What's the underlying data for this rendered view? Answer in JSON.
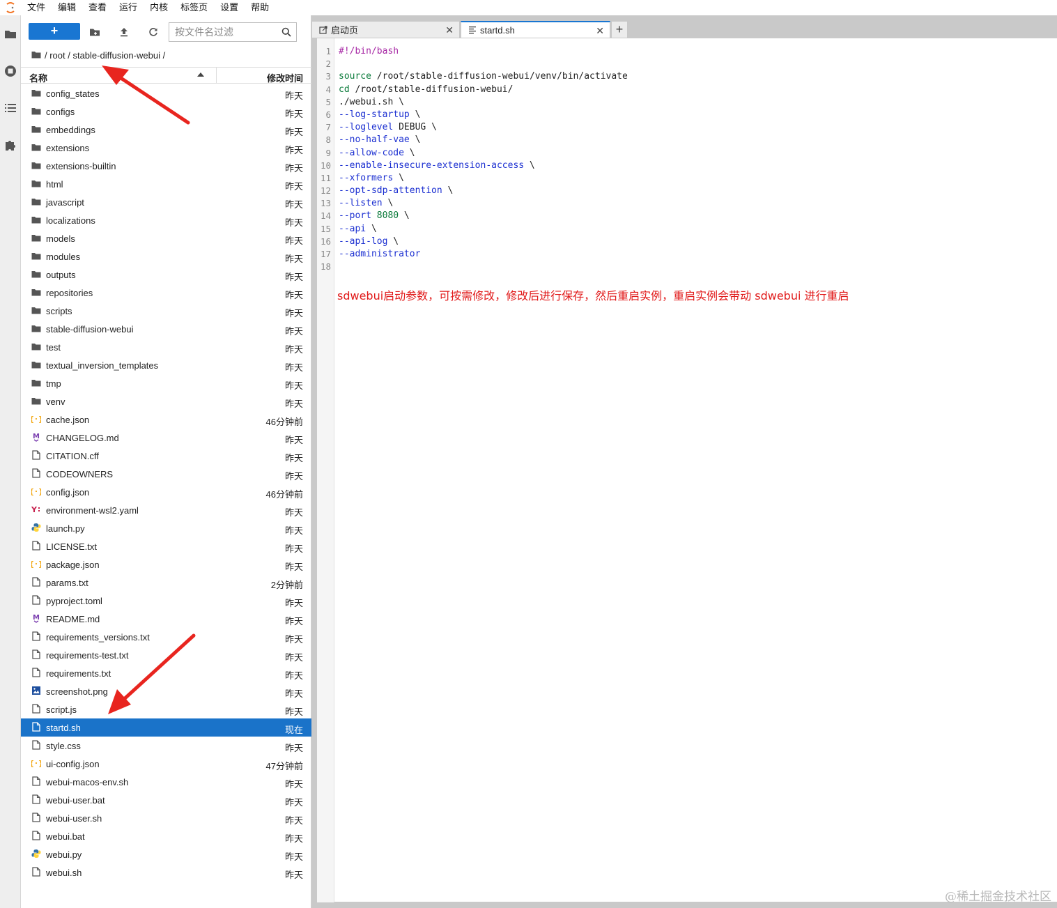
{
  "menubar": {
    "items": [
      "文件",
      "编辑",
      "查看",
      "运行",
      "内核",
      "标签页",
      "设置",
      "帮助"
    ]
  },
  "toolbar": {
    "new_label": "+",
    "filter_placeholder": "按文件名过滤",
    "icons": [
      "new-folder-icon",
      "upload-icon",
      "refresh-icon",
      "search-icon"
    ]
  },
  "breadcrumb": {
    "path": "/ root / stable-diffusion-webui /"
  },
  "filelist": {
    "header_name": "名称",
    "header_modified": "修改时间",
    "files": [
      {
        "name": "config_states",
        "type": "folder",
        "modified": "昨天"
      },
      {
        "name": "configs",
        "type": "folder",
        "modified": "昨天"
      },
      {
        "name": "embeddings",
        "type": "folder",
        "modified": "昨天"
      },
      {
        "name": "extensions",
        "type": "folder",
        "modified": "昨天"
      },
      {
        "name": "extensions-builtin",
        "type": "folder",
        "modified": "昨天"
      },
      {
        "name": "html",
        "type": "folder",
        "modified": "昨天"
      },
      {
        "name": "javascript",
        "type": "folder",
        "modified": "昨天"
      },
      {
        "name": "localizations",
        "type": "folder",
        "modified": "昨天"
      },
      {
        "name": "models",
        "type": "folder",
        "modified": "昨天"
      },
      {
        "name": "modules",
        "type": "folder",
        "modified": "昨天"
      },
      {
        "name": "outputs",
        "type": "folder",
        "modified": "昨天"
      },
      {
        "name": "repositories",
        "type": "folder",
        "modified": "昨天"
      },
      {
        "name": "scripts",
        "type": "folder",
        "modified": "昨天"
      },
      {
        "name": "stable-diffusion-webui",
        "type": "folder",
        "modified": "昨天"
      },
      {
        "name": "test",
        "type": "folder",
        "modified": "昨天"
      },
      {
        "name": "textual_inversion_templates",
        "type": "folder",
        "modified": "昨天"
      },
      {
        "name": "tmp",
        "type": "folder",
        "modified": "昨天"
      },
      {
        "name": "venv",
        "type": "folder",
        "modified": "昨天"
      },
      {
        "name": "cache.json",
        "type": "json",
        "modified": "46分钟前"
      },
      {
        "name": "CHANGELOG.md",
        "type": "markdown",
        "modified": "昨天"
      },
      {
        "name": "CITATION.cff",
        "type": "file",
        "modified": "昨天"
      },
      {
        "name": "CODEOWNERS",
        "type": "file",
        "modified": "昨天"
      },
      {
        "name": "config.json",
        "type": "json",
        "modified": "46分钟前"
      },
      {
        "name": "environment-wsl2.yaml",
        "type": "yaml",
        "modified": "昨天"
      },
      {
        "name": "launch.py",
        "type": "python",
        "modified": "昨天"
      },
      {
        "name": "LICENSE.txt",
        "type": "file",
        "modified": "昨天"
      },
      {
        "name": "package.json",
        "type": "json",
        "modified": "昨天"
      },
      {
        "name": "params.txt",
        "type": "file",
        "modified": "2分钟前"
      },
      {
        "name": "pyproject.toml",
        "type": "file",
        "modified": "昨天"
      },
      {
        "name": "README.md",
        "type": "markdown",
        "modified": "昨天"
      },
      {
        "name": "requirements_versions.txt",
        "type": "file",
        "modified": "昨天"
      },
      {
        "name": "requirements-test.txt",
        "type": "file",
        "modified": "昨天"
      },
      {
        "name": "requirements.txt",
        "type": "file",
        "modified": "昨天"
      },
      {
        "name": "screenshot.png",
        "type": "image",
        "modified": "昨天"
      },
      {
        "name": "script.js",
        "type": "file",
        "modified": "昨天"
      },
      {
        "name": "startd.sh",
        "type": "file",
        "modified": "现在",
        "selected": true
      },
      {
        "name": "style.css",
        "type": "file",
        "modified": "昨天"
      },
      {
        "name": "ui-config.json",
        "type": "json",
        "modified": "47分钟前"
      },
      {
        "name": "webui-macos-env.sh",
        "type": "file",
        "modified": "昨天"
      },
      {
        "name": "webui-user.bat",
        "type": "file",
        "modified": "昨天"
      },
      {
        "name": "webui-user.sh",
        "type": "file",
        "modified": "昨天"
      },
      {
        "name": "webui.bat",
        "type": "file",
        "modified": "昨天"
      },
      {
        "name": "webui.py",
        "type": "python",
        "modified": "昨天"
      },
      {
        "name": "webui.sh",
        "type": "file",
        "modified": "昨天"
      }
    ]
  },
  "tabs": [
    {
      "label": "启动页",
      "icon": "launcher-icon",
      "active": false
    },
    {
      "label": "startd.sh",
      "icon": "text-file-icon",
      "active": true
    }
  ],
  "add_tab_label": "+",
  "close_glyph": "✕",
  "editor": {
    "lines": [
      {
        "n": "1",
        "parts": [
          {
            "t": "#!/bin/bash",
            "c": "comment"
          }
        ]
      },
      {
        "n": "2",
        "parts": []
      },
      {
        "n": "3",
        "parts": [
          {
            "t": "source",
            "c": "kw"
          },
          {
            "t": " /root/stable-diffusion-webui/venv/bin/activate",
            "c": ""
          }
        ]
      },
      {
        "n": "4",
        "parts": [
          {
            "t": "cd",
            "c": "kw"
          },
          {
            "t": " /root/stable-diffusion-webui/",
            "c": ""
          }
        ]
      },
      {
        "n": "5",
        "parts": [
          {
            "t": "./webui.sh \\",
            "c": ""
          }
        ]
      },
      {
        "n": "6",
        "parts": [
          {
            "t": "--log-startup",
            "c": "flag"
          },
          {
            "t": " \\",
            "c": ""
          }
        ]
      },
      {
        "n": "7",
        "parts": [
          {
            "t": "--loglevel",
            "c": "flag"
          },
          {
            "t": " DEBUG \\",
            "c": ""
          }
        ]
      },
      {
        "n": "8",
        "parts": [
          {
            "t": "--no-half-vae",
            "c": "flag"
          },
          {
            "t": " \\",
            "c": ""
          }
        ]
      },
      {
        "n": "9",
        "parts": [
          {
            "t": "--allow-code",
            "c": "flag"
          },
          {
            "t": " \\",
            "c": ""
          }
        ]
      },
      {
        "n": "10",
        "parts": [
          {
            "t": "--enable-insecure-extension-access",
            "c": "flag"
          },
          {
            "t": " \\",
            "c": ""
          }
        ]
      },
      {
        "n": "11",
        "parts": [
          {
            "t": "--xformers",
            "c": "flag"
          },
          {
            "t": " \\",
            "c": ""
          }
        ]
      },
      {
        "n": "12",
        "parts": [
          {
            "t": "--opt-sdp-attention",
            "c": "flag"
          },
          {
            "t": " \\",
            "c": ""
          }
        ]
      },
      {
        "n": "13",
        "parts": [
          {
            "t": "--listen",
            "c": "flag"
          },
          {
            "t": " \\",
            "c": ""
          }
        ]
      },
      {
        "n": "14",
        "parts": [
          {
            "t": "--port",
            "c": "flag"
          },
          {
            "t": " ",
            "c": ""
          },
          {
            "t": "8080",
            "c": "num"
          },
          {
            "t": " \\",
            "c": ""
          }
        ]
      },
      {
        "n": "15",
        "parts": [
          {
            "t": "--api",
            "c": "flag"
          },
          {
            "t": " \\",
            "c": ""
          }
        ]
      },
      {
        "n": "16",
        "parts": [
          {
            "t": "--api-log",
            "c": "flag"
          },
          {
            "t": " \\",
            "c": ""
          }
        ]
      },
      {
        "n": "17",
        "parts": [
          {
            "t": "--administrator",
            "c": "flag"
          }
        ]
      },
      {
        "n": "18",
        "parts": []
      }
    ],
    "annotation": "sdwebui启动参数，可按需修改，修改后进行保存，然后重启实例，重启实例会带动 sdwebui 进行重启"
  },
  "watermark": "@稀土掘金技术社区",
  "colors": {
    "accent": "#1976d2",
    "selected_row": "#1a73c9",
    "annotation_red": "#e11a1a",
    "arrow_red": "#e8251f"
  }
}
